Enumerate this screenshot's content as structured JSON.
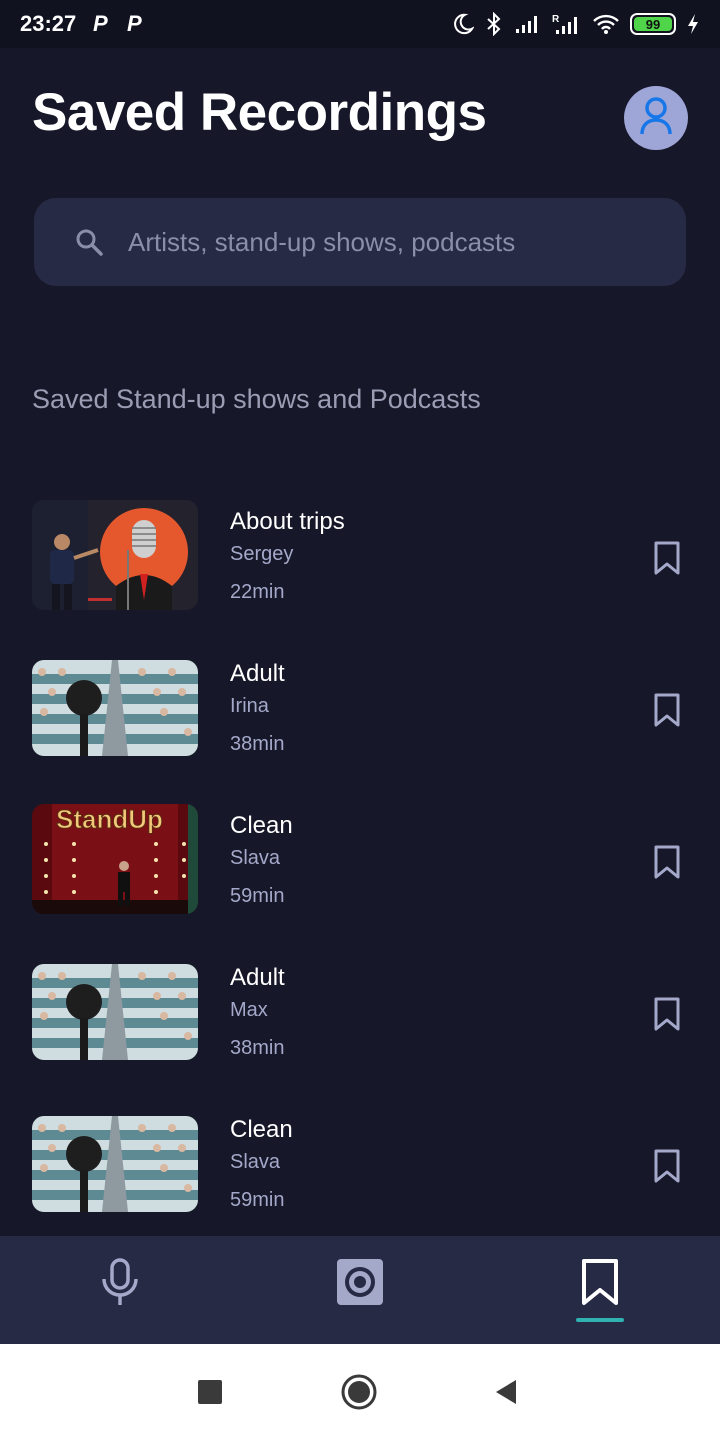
{
  "status_bar": {
    "time": "23:27",
    "notification_icons": [
      "P",
      "P"
    ],
    "battery_level": "99",
    "icons": [
      "moon-icon",
      "bluetooth-icon",
      "signal-icon",
      "roaming-signal-icon",
      "wifi-icon",
      "battery-icon",
      "charging-icon"
    ]
  },
  "header": {
    "title": "Saved Recordings",
    "avatar_icon": "user-icon"
  },
  "search": {
    "placeholder": "Artists, stand-up shows, podcasts",
    "value": ""
  },
  "section": {
    "heading": "Saved Stand-up shows and Podcasts"
  },
  "recordings": [
    {
      "title": "About trips",
      "author": "Sergey",
      "duration": "22min",
      "thumbnail": "retro-microphone-comedian"
    },
    {
      "title": "Adult",
      "author": "Irina",
      "duration": "38min",
      "thumbnail": "microphone-audience"
    },
    {
      "title": "Clean",
      "author": "Slava",
      "duration": "59min",
      "thumbnail": "standup-stage"
    },
    {
      "title": "Adult",
      "author": "Max",
      "duration": "38min",
      "thumbnail": "microphone-audience"
    },
    {
      "title": "Clean",
      "author": "Slava",
      "duration": "59min",
      "thumbnail": "microphone-audience"
    }
  ],
  "thumbnail_text": {
    "standup_sign": "StandUp"
  },
  "bottom_nav": {
    "items": [
      "microphone-icon",
      "speaker-icon",
      "bookmark-icon"
    ],
    "active": "bookmark-icon"
  },
  "colors": {
    "background": "#161728",
    "surface": "#272a45",
    "accent": "#2fb3b0",
    "avatar": "#9ea6d8",
    "secondary_text": "#a4a8c9"
  }
}
